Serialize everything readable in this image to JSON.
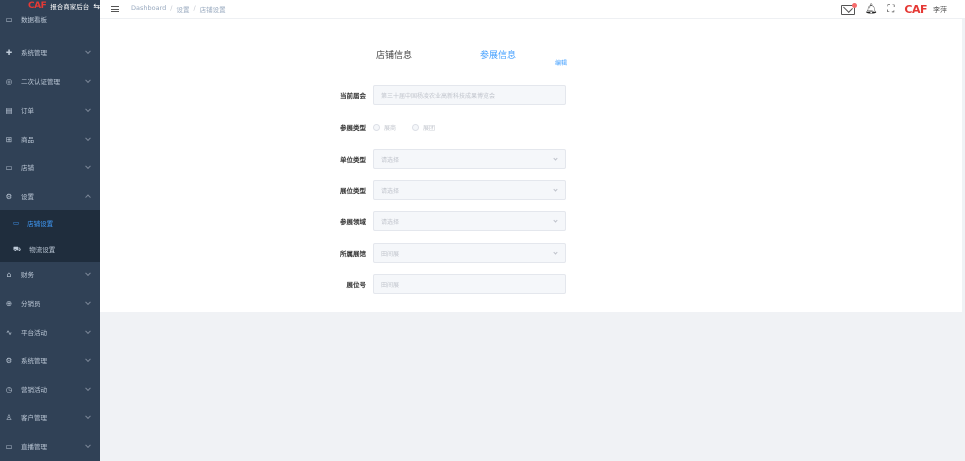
{
  "brand": {
    "logo": "CAF",
    "title": "报合商家后台"
  },
  "sidebar": {
    "top_item": "数据看板",
    "items": [
      {
        "label": "系统管理",
        "icon": "circle-plus-icon"
      },
      {
        "label": "二次认证管理",
        "icon": "eye-icon"
      },
      {
        "label": "订单",
        "icon": "document-icon"
      },
      {
        "label": "商品",
        "icon": "grid-icon"
      },
      {
        "label": "店铺",
        "icon": "monitor-icon"
      },
      {
        "label": "设置",
        "icon": "gear-icon"
      },
      {
        "label": "财务",
        "icon": "bank-icon"
      },
      {
        "label": "分销员",
        "icon": "globe-icon"
      },
      {
        "label": "平台活动",
        "icon": "chart-icon"
      },
      {
        "label": "系统管理",
        "icon": "gear-icon"
      },
      {
        "label": "营销活动",
        "icon": "clock-icon"
      },
      {
        "label": "客户管理",
        "icon": "user-icon"
      },
      {
        "label": "直播管理",
        "icon": "video-icon"
      }
    ],
    "sub_items": [
      {
        "label": "店铺设置",
        "icon": "monitor-icon"
      },
      {
        "label": "物流设置",
        "icon": "truck-icon"
      }
    ]
  },
  "topbar": {
    "breadcrumb": [
      "Dashboard",
      "设置",
      "店铺设置"
    ],
    "user_logo": "CAF",
    "user_name": "李萍"
  },
  "tabs": {
    "shop_info": "店铺信息",
    "exhibit_info": "参展信息",
    "edit": "编辑"
  },
  "form": {
    "session": {
      "label": "当前届会",
      "value": "第三十届中国杨凌农业高新科技成果博览会"
    },
    "exhibit_type": {
      "label": "参展类型",
      "options": [
        "展商",
        "展团"
      ]
    },
    "unit_type": {
      "label": "单位类型",
      "placeholder": "请选择"
    },
    "booth_type": {
      "label": "展位类型",
      "placeholder": "请选择"
    },
    "exhibit_area": {
      "label": "参展领域",
      "placeholder": "请选择"
    },
    "hall": {
      "label": "所属展馆",
      "placeholder": "田间展"
    },
    "booth_no": {
      "label": "展位号",
      "placeholder": "田间展"
    }
  },
  "colors": {
    "sidebar_bg": "#304156",
    "sub_bg": "#1f2d3d",
    "accent": "#409eff",
    "brand_red": "#e53935"
  }
}
